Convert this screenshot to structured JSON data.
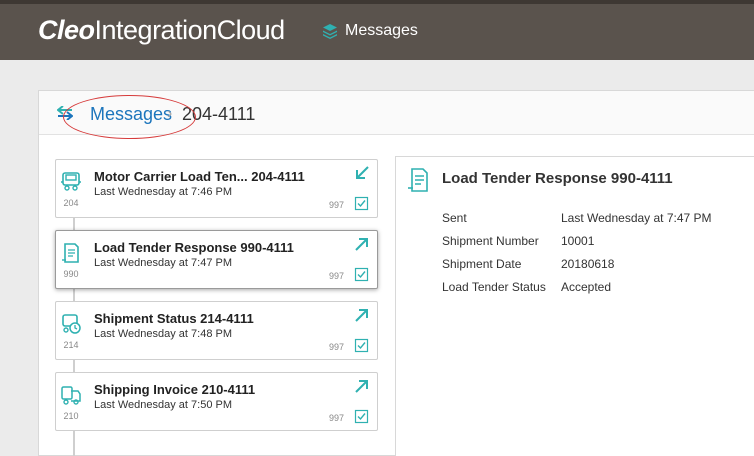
{
  "header": {
    "brand_part1": "Cleo",
    "brand_part2": "IntegrationCloud",
    "nav_label": "Messages",
    "accent": "#2fb1b1"
  },
  "breadcrumb": {
    "parent": "Messages",
    "separator": "›",
    "current": "204-4111"
  },
  "messages": [
    {
      "code": "204",
      "title": "Motor Carrier Load Ten...  204-4111",
      "time": "Last Wednesday at 7:46 PM",
      "ack": "997",
      "direction": "inbound",
      "icon": "truck-icon"
    },
    {
      "code": "990",
      "title": "Load Tender Response  990-4111",
      "time": "Last Wednesday at 7:47 PM",
      "ack": "997",
      "direction": "outbound",
      "icon": "document-icon"
    },
    {
      "code": "214",
      "title": "Shipment Status  214-4111",
      "time": "Last Wednesday at 7:48 PM",
      "ack": "997",
      "direction": "outbound",
      "icon": "truck-status-icon"
    },
    {
      "code": "210",
      "title": "Shipping Invoice  210-4111",
      "time": "Last Wednesday at 7:50 PM",
      "ack": "997",
      "direction": "outbound",
      "icon": "invoice-icon"
    }
  ],
  "detail": {
    "title": "Load Tender Response  990-4111",
    "fields": [
      {
        "label": "Sent",
        "value": "Last Wednesday at 7:47 PM"
      },
      {
        "label": "Shipment Number",
        "value": "10001"
      },
      {
        "label": "Shipment Date",
        "value": "20180618"
      },
      {
        "label": "Load Tender Status",
        "value": "Accepted"
      }
    ]
  }
}
